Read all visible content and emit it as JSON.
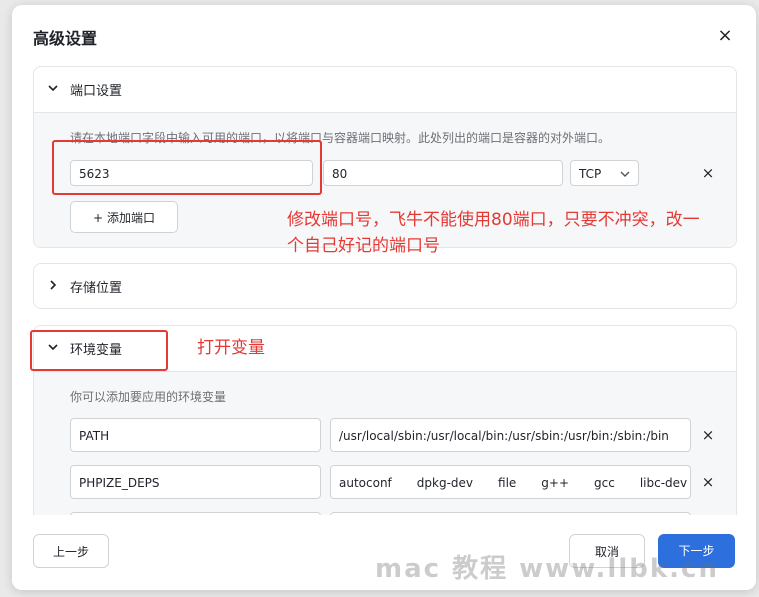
{
  "dialog": {
    "title": "高级设置",
    "close_symbol": "×"
  },
  "port_section": {
    "title": "端口设置",
    "hint": "请在本地端口字段中输入可用的端口，以将端口与容器端口映射。此处列出的端口是容器的对外端口。",
    "host_port": "5623",
    "container_port": "80",
    "protocol": "TCP",
    "remove_symbol": "×",
    "add_label": "添加端口"
  },
  "storage_section": {
    "title": "存储位置"
  },
  "env_section": {
    "title": "环境变量",
    "hint": "你可以添加要应用的环境变量",
    "rows": [
      {
        "key": "PATH",
        "value": "/usr/local/sbin:/usr/local/bin:/usr/sbin:/usr/bin:/sbin:/bin"
      },
      {
        "key": "PHPIZE_DEPS",
        "value_tokens": [
          "autoconf",
          "dpkg-dev",
          "file",
          "g++",
          "gcc",
          "libc-dev"
        ]
      }
    ],
    "remove_symbol": "×"
  },
  "annotations": {
    "port_note": "修改端口号，飞牛不能使用80端口，只要不冲突，改一个自己好记的端口号",
    "env_note": "打开变量",
    "color": "#e53935"
  },
  "footer": {
    "prev_label": "上一步",
    "cancel_label": "取消",
    "next_label": "下一步",
    "primary_color": "#2e6fde"
  },
  "watermark": "mac 教程 www.llbk.cn"
}
